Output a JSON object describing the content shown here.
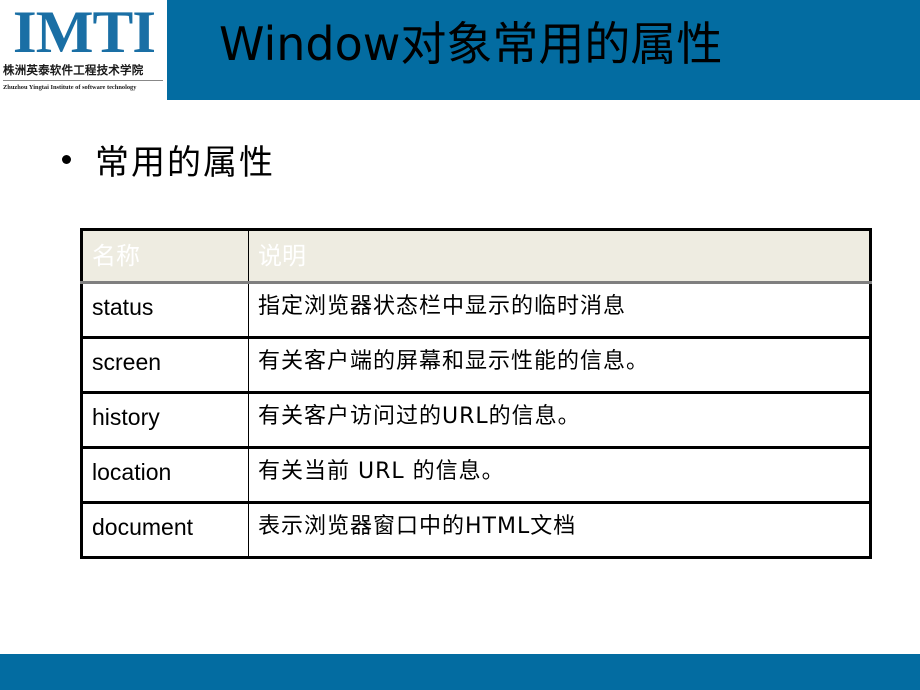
{
  "logo": {
    "main": "IMTI",
    "cn": "株洲英泰软件工程技术学院",
    "en": "Zhuzhou Yingtai Institute of software technology"
  },
  "header": {
    "title": "Window对象常用的属性"
  },
  "bullet": {
    "text": "常用的属性"
  },
  "table": {
    "columns": [
      "名称",
      "说明"
    ],
    "rows": [
      {
        "name": "status",
        "desc": "指定浏览器状态栏中显示的临时消息"
      },
      {
        "name": "screen",
        "desc": "有关客户端的屏幕和显示性能的信息。"
      },
      {
        "name": "history",
        "desc": "有关客户访问过的URL的信息。"
      },
      {
        "name": "location",
        "desc": "有关当前 URL 的信息。"
      },
      {
        "name": "document",
        "desc": "表示浏览器窗口中的HTML文档"
      }
    ]
  },
  "colors": {
    "brand_blue": "#036ca1",
    "logo_blue": "#1a6fa5",
    "table_header_bg": "#eeece1"
  }
}
